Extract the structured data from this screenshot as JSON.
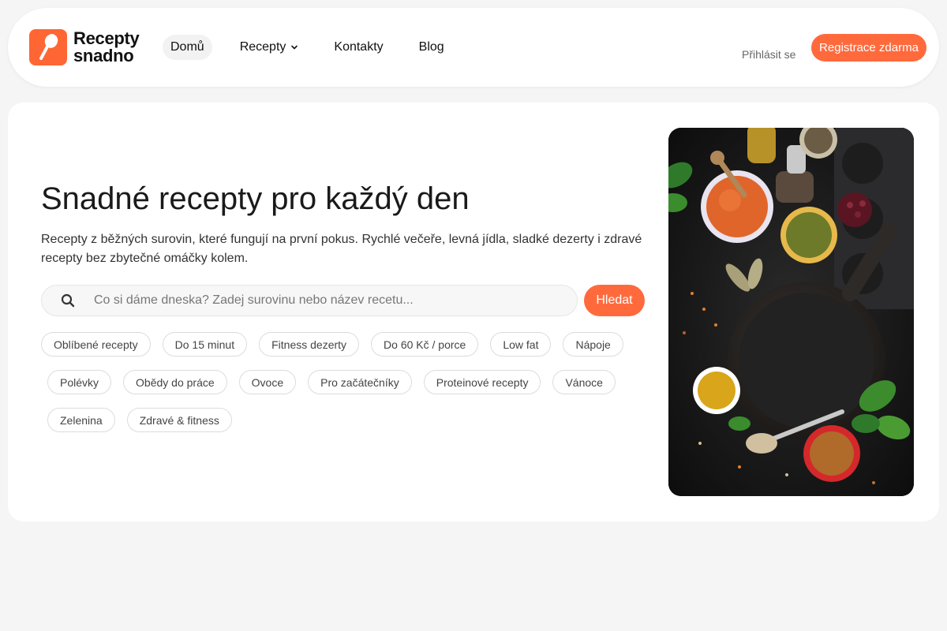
{
  "brand": {
    "name_line1": "Recepty",
    "name_line2": "snadno",
    "accent": "#ff6a3d",
    "logo_icon": "spoon-icon"
  },
  "nav": {
    "items": [
      {
        "label": "Domů",
        "active": true
      },
      {
        "label": "Recepty",
        "has_dropdown": true
      },
      {
        "label": "Kontakty"
      },
      {
        "label": "Blog"
      }
    ],
    "login_label": "Přihlásit se",
    "register_label": "Registrace zdarma"
  },
  "hero": {
    "title": "Snadné recepty pro každý den",
    "subtitle": "Recepty z běžných surovin, které fungují na první pokus. Rychlé večeře, levná jídla, sladké dezerty i zdravé recepty bez zbytečné omáčky kolem.",
    "search_placeholder": "Co si dáme dneska? Zadej surovinu nebo název recetu...",
    "search_button": "Hledat",
    "image_icon": "food-photo"
  },
  "tags": [
    [
      "Oblíbené recepty",
      "Do 15 minut",
      "Fitness dezerty",
      "Do 60 Kč / porce",
      "Low fat",
      "Nápoje"
    ],
    [
      "Polévky",
      "Obědy do práce",
      "Ovoce",
      "Pro začátečníky",
      "Proteinové recepty",
      "Vánoce"
    ],
    [
      "Zelenina",
      "Zdravé & fitness"
    ]
  ]
}
